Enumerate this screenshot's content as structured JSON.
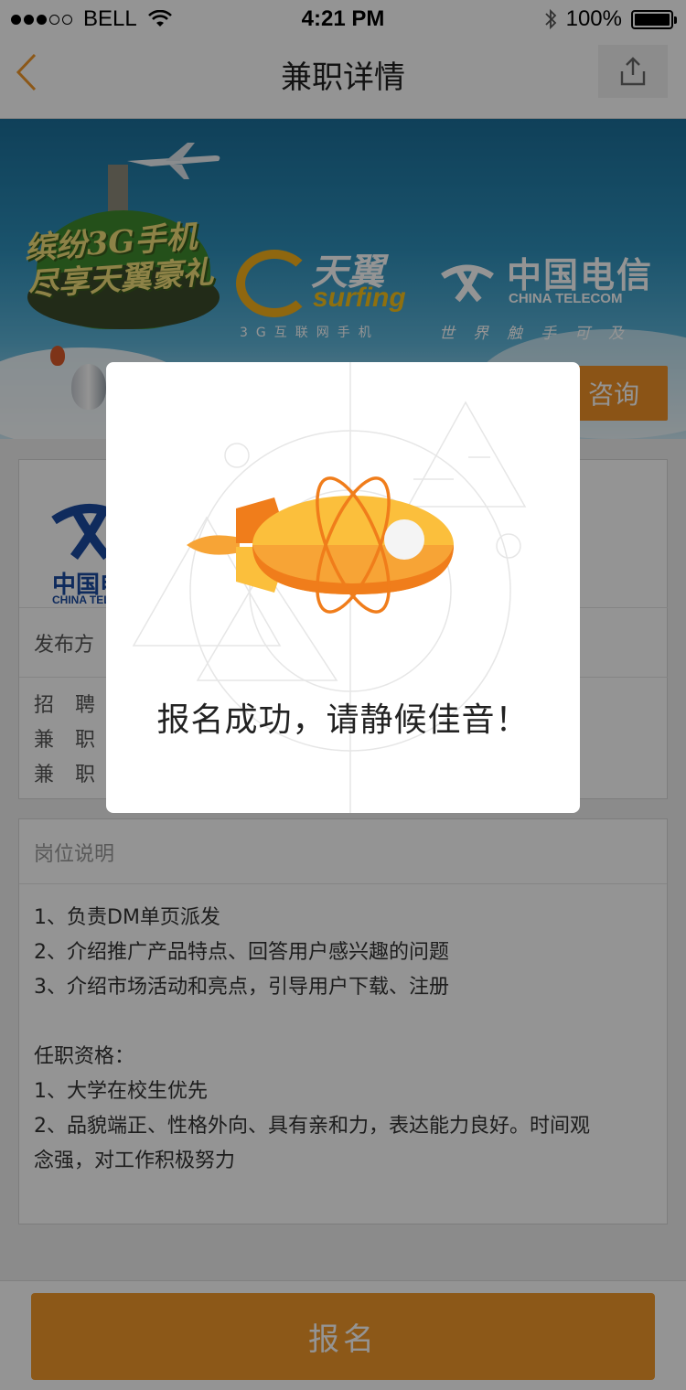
{
  "status_bar": {
    "carrier": "BELL",
    "time": "4:21 PM",
    "battery": "100%",
    "battery_level": 1.0,
    "signal_bars_filled": 3,
    "signal_bars_total": 5
  },
  "nav": {
    "title": "兼职详情",
    "back_icon": "chevron-left-icon",
    "share_icon": "share-icon"
  },
  "banner": {
    "promo_text": "缤纷3G手机 尽享天翼豪礼",
    "brand_name": "天翼",
    "brand_sub": "surfing",
    "brand_tagline": "3G互联网手机",
    "telecom_cn": "中国电信",
    "telecom_en": "CHINA TELECOM",
    "telecom_slogan": "世界触手可及",
    "consult_label": "咨询"
  },
  "company": {
    "logo_cn": "中国电信",
    "logo_en": "CHINA TELECOM",
    "publisher_label": "发布方",
    "info": [
      "招 聘 人",
      "兼 职 地",
      "兼 职 时"
    ]
  },
  "description": {
    "header": "岗位说明",
    "duties": [
      "1、负责DM单页派发",
      "2、介绍推广产品特点、回答用户感兴趣的问题",
      "3、介绍市场活动和亮点，引导用户下载、注册"
    ],
    "qual_title": "任职资格：",
    "quals": [
      "1、大学在校生优先",
      "2、品貌端正、性格外向、具有亲和力，表达能力良好。时间观",
      "念强，对工作积极努力"
    ]
  },
  "bottom": {
    "signup_label": "报名"
  },
  "modal": {
    "message": "报名成功，请静候佳音！"
  },
  "colors": {
    "accent": "#f2982a",
    "rocket_body": "#fbbf3c",
    "rocket_dark": "#f07d1b"
  }
}
